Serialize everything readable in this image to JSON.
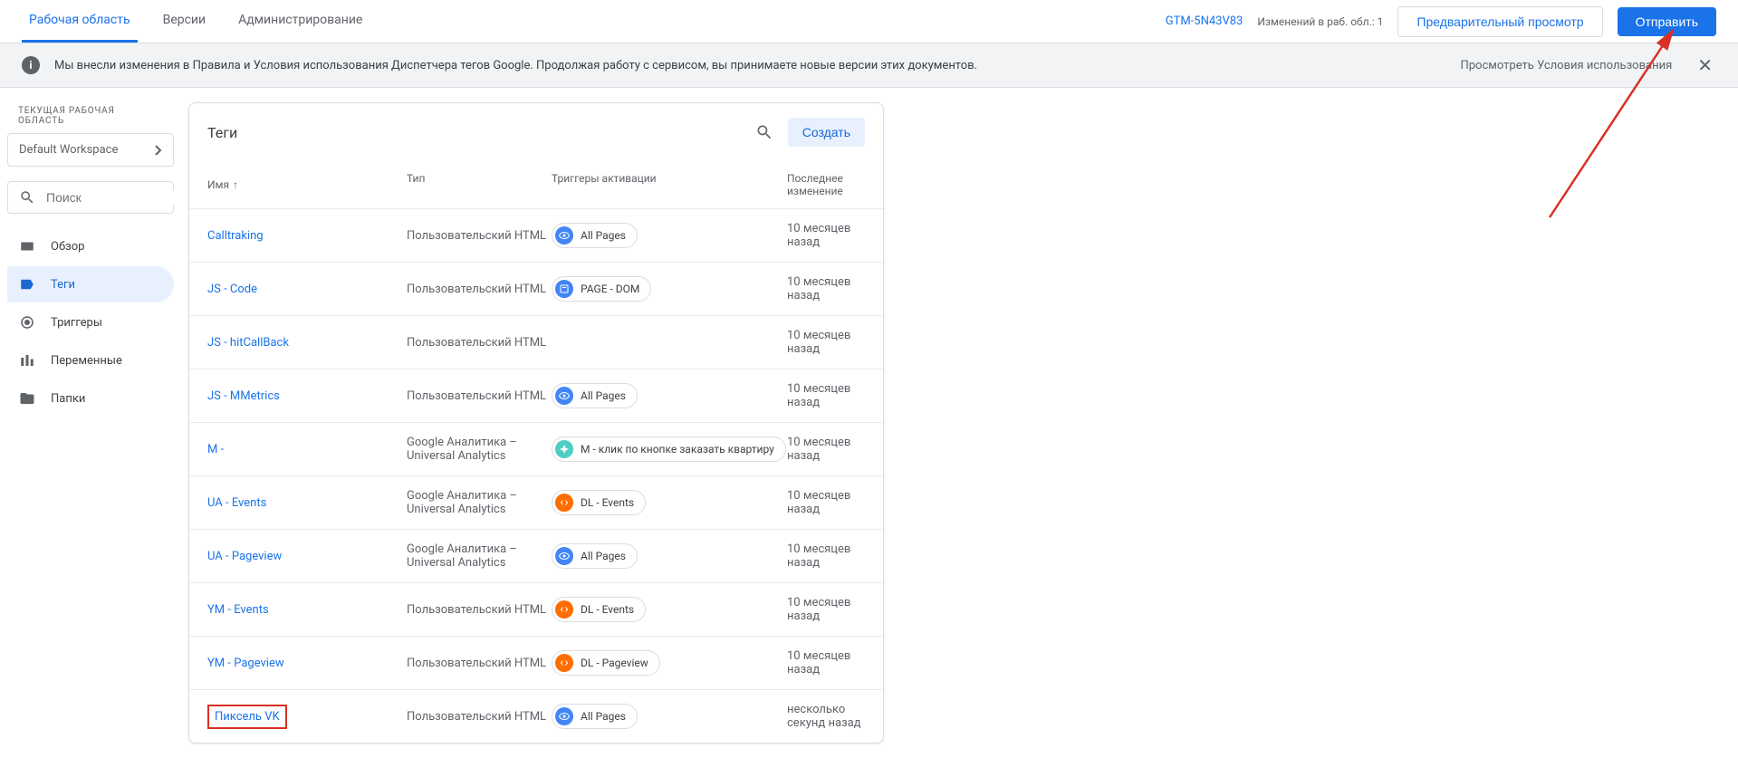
{
  "topbar": {
    "tabs": {
      "workspace": "Рабочая область",
      "versions": "Версии",
      "admin": "Администрирование"
    },
    "container_id": "GTM-5N43V83",
    "changes": "Изменений в раб. обл.: 1",
    "preview_btn": "Предварительный просмотр",
    "submit_btn": "Отправить"
  },
  "notice": {
    "text": "Мы внесли изменения в Правила и Условия использования Диспетчера тегов Google. Продолжая работу с сервисом, вы принимаете новые версии этих документов.",
    "link": "Просмотреть Условия использования"
  },
  "sidebar": {
    "workspace_label": "ТЕКУЩАЯ РАБОЧАЯ ОБЛАСТЬ",
    "workspace_name": "Default Workspace",
    "search_placeholder": "Поиск",
    "nav": {
      "overview": "Обзор",
      "tags": "Теги",
      "triggers": "Триггеры",
      "variables": "Переменные",
      "folders": "Папки"
    }
  },
  "card": {
    "title": "Теги",
    "create_btn": "Создать",
    "columns": {
      "name": "Имя",
      "type": "Тип",
      "triggers": "Триггеры активации",
      "modified": "Последнее изменение"
    }
  },
  "types": {
    "custom_html": "Пользовательский HTML",
    "ga_universal": "Google Аналитика – Universal Analytics"
  },
  "triggers": {
    "all_pages": "All Pages",
    "page_dom": "PAGE - DOM",
    "m_click": "M - клик по кнопке заказать квартиру",
    "dl_events": "DL - Events",
    "dl_pageview": "DL - Pageview"
  },
  "modified": {
    "ten_months": "10 месяцев назад",
    "seconds_ago": "несколько секунд назад"
  },
  "rows": {
    "r0": {
      "name": "Calltraking"
    },
    "r1": {
      "name": "JS - Code"
    },
    "r2": {
      "name": "JS - hitCallBack"
    },
    "r3": {
      "name": "JS - MMetrics"
    },
    "r4": {
      "name": "M -"
    },
    "r5": {
      "name": "UA - Events"
    },
    "r6": {
      "name": "UA - Pageview"
    },
    "r7": {
      "name": "YM - Events"
    },
    "r8": {
      "name": "YM - Pageview"
    },
    "r9": {
      "name": "Пиксель VK"
    }
  }
}
